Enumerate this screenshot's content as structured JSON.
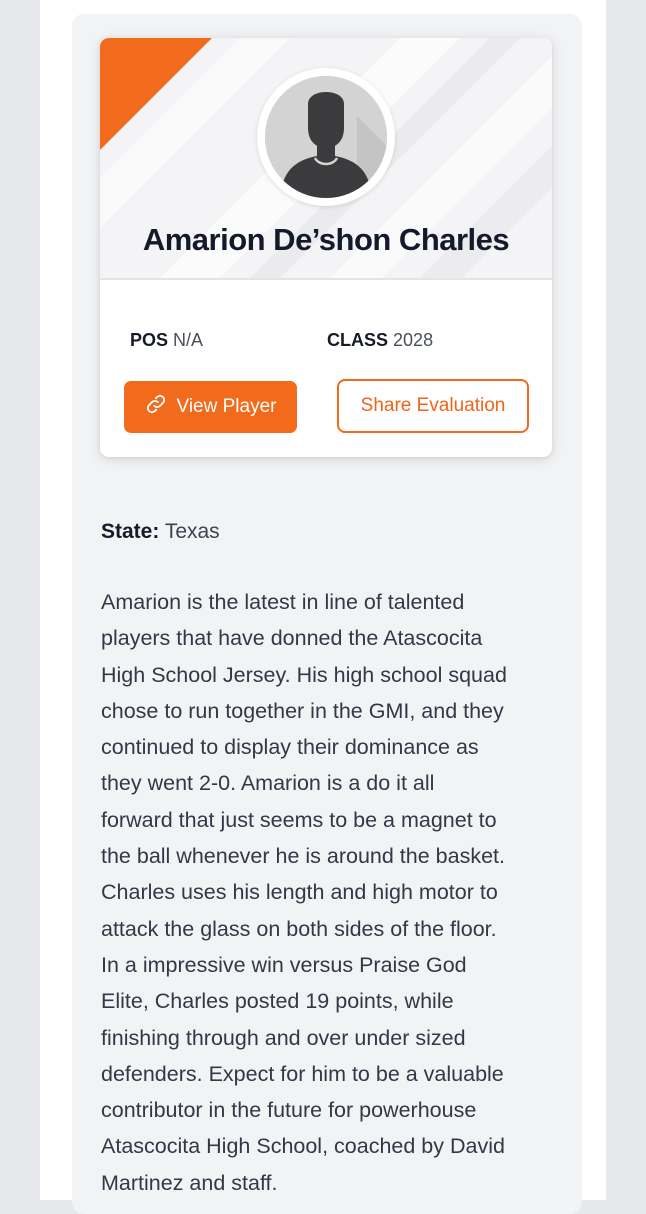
{
  "player": {
    "name": "Amarion De’shon Charles",
    "pos_label": "POS",
    "pos_value": "N/A",
    "class_label": "CLASS",
    "class_value": "2028"
  },
  "buttons": {
    "view_player": "View Player",
    "view_player_icon": "link-icon",
    "share_evaluation": "Share Evaluation"
  },
  "details": {
    "state_label": "State:",
    "state_value": "Texas"
  },
  "bio_lines": [
    "Amarion is the latest in line of talented",
    "players that have donned the Atascocita",
    "High School Jersey. His high school squad",
    "chose to run together in the GMI, and they",
    "continued to display their dominance as",
    "they went 2-0. Amarion is a do it all",
    "forward that just seems to be a magnet to",
    "the ball whenever he is around the basket.",
    "Charles uses his length and high motor to",
    "attack the glass on both sides of the floor.",
    "In a impressive win versus Praise God",
    "Elite, Charles posted 19 points, while",
    "finishing through and over under sized",
    "defenders. Expect for him to be a valuable",
    "contributor in the future for powerhouse",
    "Atascocita High School, coached by David",
    "Martinez and staff."
  ],
  "colors": {
    "accent": "#f26a1b",
    "heading": "#14192b",
    "body_text": "#333846",
    "panel_bg": "#f2f3f5"
  }
}
